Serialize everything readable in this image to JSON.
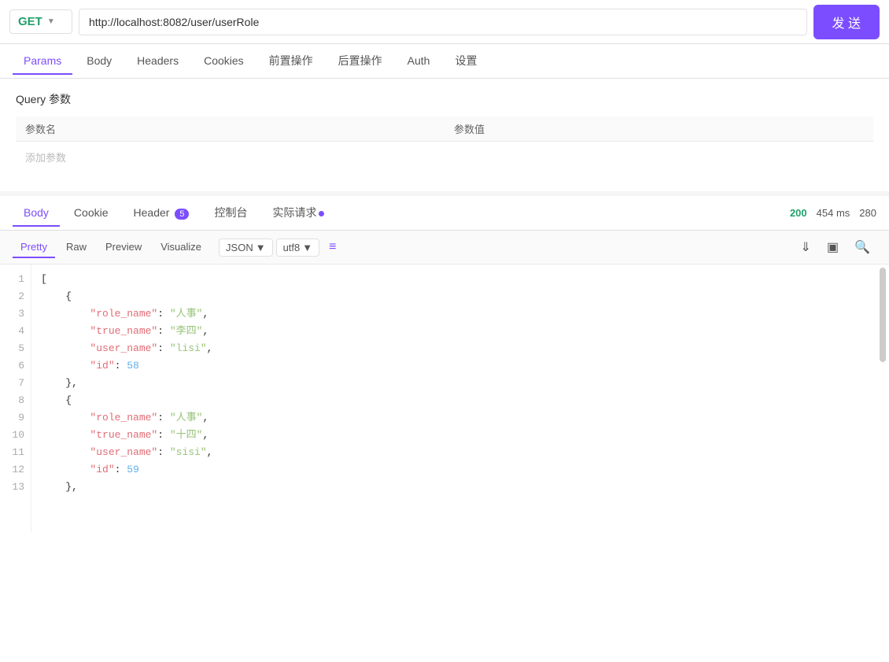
{
  "topbar": {
    "method": "GET",
    "url": "http://localhost:8082/user/userRole",
    "send_label": "发 送"
  },
  "request_tabs": [
    {
      "label": "Params",
      "active": true
    },
    {
      "label": "Body"
    },
    {
      "label": "Headers"
    },
    {
      "label": "Cookies"
    },
    {
      "label": "前置操作"
    },
    {
      "label": "后置操作"
    },
    {
      "label": "Auth"
    },
    {
      "label": "设置"
    }
  ],
  "params_section": {
    "title": "Query 参数",
    "col_name": "参数名",
    "col_value": "参数值",
    "add_placeholder": "添加参数"
  },
  "response_tabs": [
    {
      "label": "Body",
      "active": true
    },
    {
      "label": "Cookie"
    },
    {
      "label": "Header",
      "badge": "5"
    },
    {
      "label": "控制台"
    },
    {
      "label": "实际请求",
      "dot": true
    }
  ],
  "response_meta": {
    "status": "200",
    "time": "454 ms",
    "size": "280"
  },
  "body_tabs": [
    {
      "label": "Pretty",
      "active": true
    },
    {
      "label": "Raw"
    },
    {
      "label": "Preview"
    },
    {
      "label": "Visualize"
    }
  ],
  "format": "JSON",
  "encoding": "utf8",
  "code_lines": [
    {
      "num": 1,
      "content": "[",
      "type": "bracket"
    },
    {
      "num": 2,
      "content": "    {",
      "type": "bracket"
    },
    {
      "num": 3,
      "content": "        \"role_name\": \"人事\",",
      "type": "kv",
      "key": "role_name",
      "val": "人事"
    },
    {
      "num": 4,
      "content": "        \"true_name\": \"李四\",",
      "type": "kv",
      "key": "true_name",
      "val": "李四"
    },
    {
      "num": 5,
      "content": "        \"user_name\": \"lisi\",",
      "type": "kv",
      "key": "user_name",
      "val": "lisi"
    },
    {
      "num": 6,
      "content": "        \"id\": 58",
      "type": "kvnum",
      "key": "id",
      "val": 58
    },
    {
      "num": 7,
      "content": "    },",
      "type": "bracket"
    },
    {
      "num": 8,
      "content": "    {",
      "type": "bracket"
    },
    {
      "num": 9,
      "content": "        \"role_name\": \"人事\",",
      "type": "kv",
      "key": "role_name",
      "val": "人事"
    },
    {
      "num": 10,
      "content": "        \"true_name\": \"十四\",",
      "type": "kv",
      "key": "true_name",
      "val": "十四"
    },
    {
      "num": 11,
      "content": "        \"user_name\": \"sisi\",",
      "type": "kv",
      "key": "user_name",
      "val": "sisi"
    },
    {
      "num": 12,
      "content": "        \"id\": 59",
      "type": "kvnum",
      "key": "id",
      "val": 59
    },
    {
      "num": 13,
      "content": "    },",
      "type": "bracket"
    }
  ]
}
